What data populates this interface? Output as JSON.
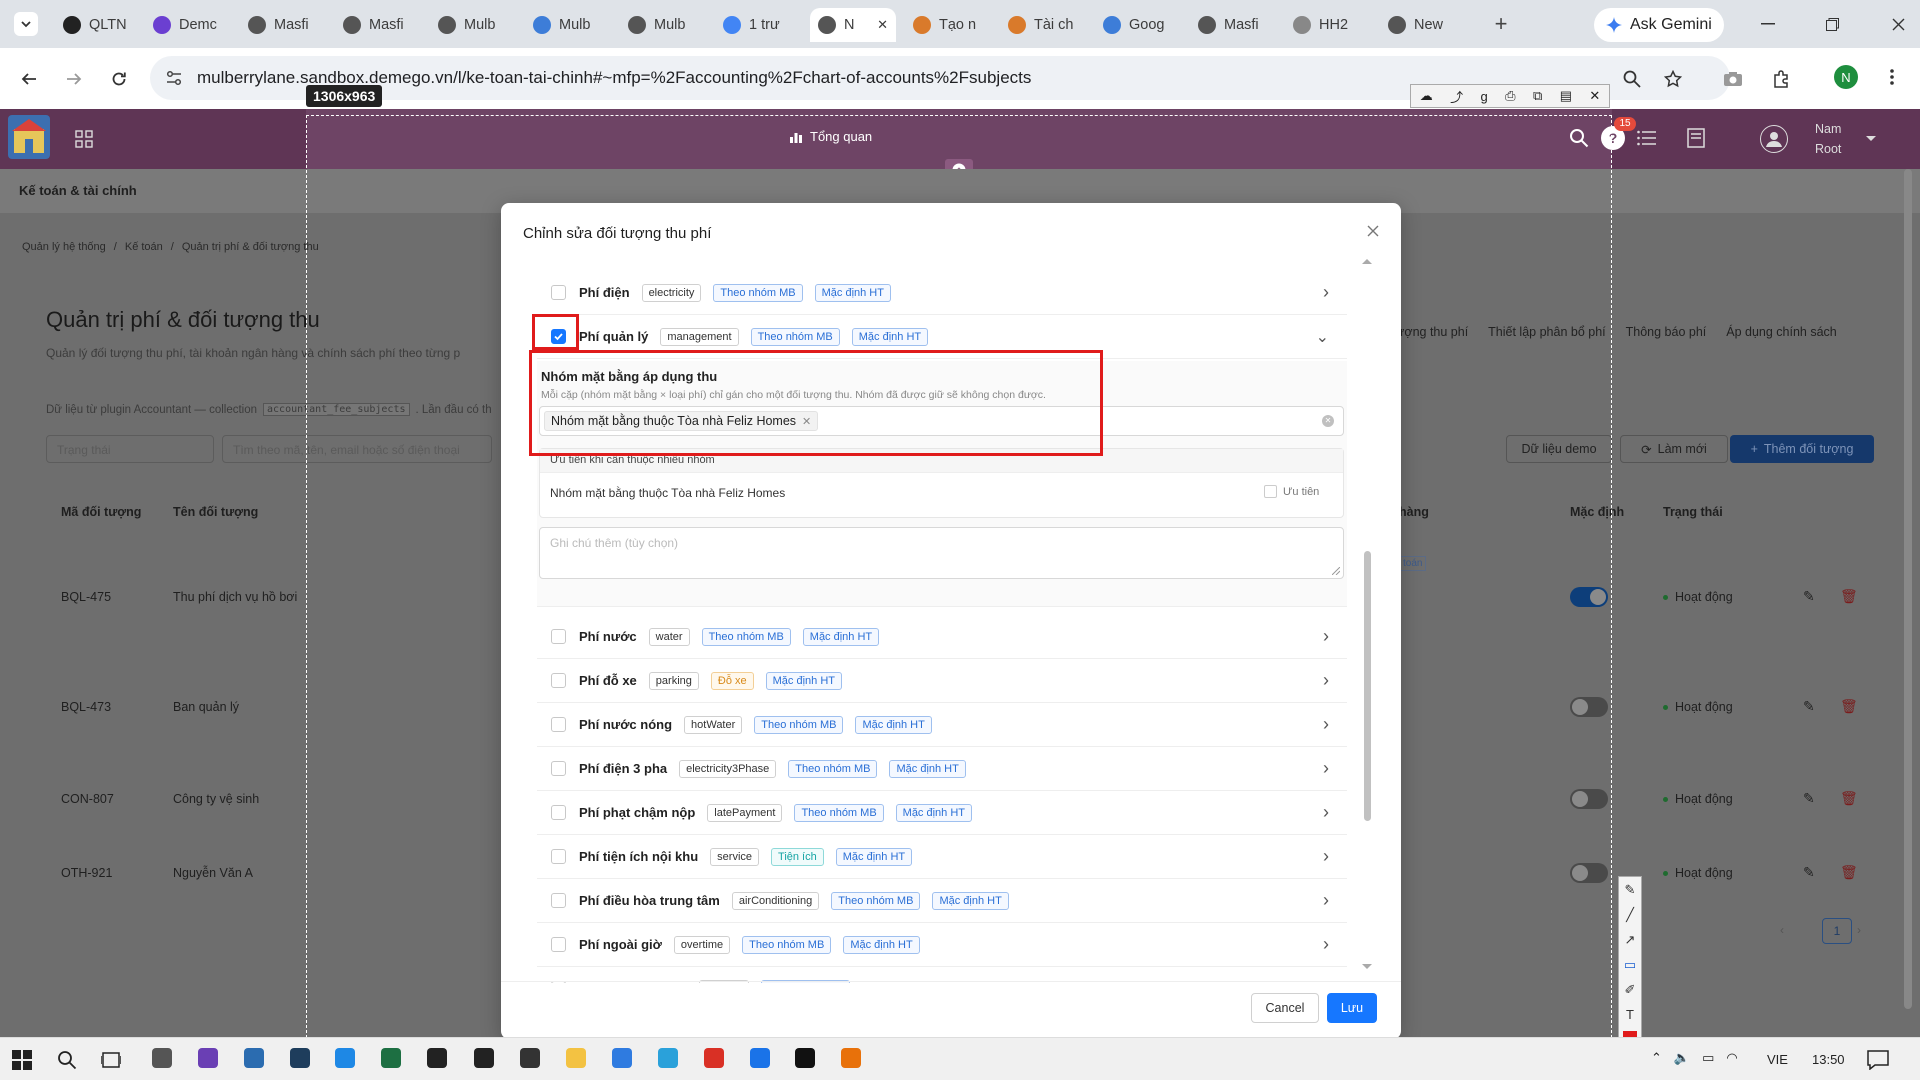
{
  "browser": {
    "tabs": [
      {
        "label": "QLTN",
        "color": "#222"
      },
      {
        "label": "Demc",
        "color": "#6b3fd1"
      },
      {
        "label": "Masfi",
        "color": "#555"
      },
      {
        "label": "Masfi",
        "color": "#555"
      },
      {
        "label": "Mulb",
        "color": "#555"
      },
      {
        "label": "Mulb",
        "color": "#3d7dd8"
      },
      {
        "label": "Mulb",
        "color": "#555"
      },
      {
        "label": "1 trư",
        "color": "#4285f4"
      },
      {
        "label": "N",
        "color": "#555"
      },
      {
        "label": "Tạo n",
        "color": "#d97a2b"
      },
      {
        "label": "Tài ch",
        "color": "#d97a2b"
      },
      {
        "label": "Goog",
        "color": "#3d7dd8"
      },
      {
        "label": "Masfi",
        "color": "#555"
      },
      {
        "label": "HH2",
        "color": "#888"
      },
      {
        "label": "New",
        "color": "#555"
      }
    ],
    "ask_gemini": "Ask Gemini",
    "url": "mulberrylane.sandbox.demego.vn/l/ke-toan-tai-chinh#~mfp=%2Faccounting%2Fchart-of-accounts%2Fsubjects",
    "profile_initial": "N"
  },
  "capture": {
    "size_label": "1306x963"
  },
  "app": {
    "header_center": "Tổng quan",
    "notification_count": "15",
    "user_first": "Nam",
    "user_last": "Root",
    "module_title": "Kế toán & tài chính",
    "breadcrumb": [
      "Quản lý hệ thống",
      "Kế toán",
      "Quản trị phí & đối tượng thu"
    ],
    "page_title": "Quản trị phí & đối tượng thu",
    "page_subtitle": "Quản lý đối tượng thu phí, tài khoản ngân hàng và chính sách phí theo từng p",
    "plugin_note": "Dữ liệu từ plugin Accountant — collection",
    "plugin_code": "accountant_fee_subjects",
    "plugin_note_tail": ". Lần đầu có th",
    "status_filter_placeholder": "Trạng thái",
    "search_placeholder": "Tìm theo mã, tên, email hoặc số điện thoại",
    "tabs_right": [
      "ượng thu phí",
      "Thiết lập phân bổ phí",
      "Thông báo phí",
      "Áp dụng chính sách"
    ],
    "btn_demo": "Dữ liệu demo",
    "btn_refresh": "Làm mới",
    "btn_add": "Thêm đối tượng",
    "table_headers": {
      "code": "Mã đối tượng",
      "name": "Tên đối tượng",
      "bank": "hàng",
      "default": "Mặc định",
      "status": "Trạng thái"
    },
    "rows": [
      {
        "code": "BQL-475",
        "name": "Thu phí dịch vụ hồ bơi",
        "status": "Hoạt động",
        "default_on": true
      },
      {
        "code": "BQL-473",
        "name": "Ban quản lý",
        "status": "Hoạt động",
        "default_on": false
      },
      {
        "code": "CON-807",
        "name": "Công ty vệ sinh",
        "status": "Hoạt động",
        "default_on": false
      },
      {
        "code": "OTH-921",
        "name": "Nguyễn Văn A",
        "status": "Hoạt động",
        "default_on": false
      }
    ],
    "bank_tag": "toán",
    "page_number": "1"
  },
  "modal": {
    "title": "Chỉnh sửa đối tượng thu phí",
    "fees": [
      {
        "name": "Phí điện",
        "code": "electricity",
        "tags": [
          {
            "t": "Theo nhóm MB",
            "c": "blue"
          },
          {
            "t": "Mặc định HT",
            "c": "blue"
          }
        ],
        "checked": false
      },
      {
        "name": "Phí quản lý",
        "code": "management",
        "tags": [
          {
            "t": "Theo nhóm MB",
            "c": "blue"
          },
          {
            "t": "Mặc định HT",
            "c": "blue"
          }
        ],
        "checked": true
      },
      {
        "name": "Phí nước",
        "code": "water",
        "tags": [
          {
            "t": "Theo nhóm MB",
            "c": "blue"
          },
          {
            "t": "Mặc định HT",
            "c": "blue"
          }
        ],
        "checked": false
      },
      {
        "name": "Phí đỗ xe",
        "code": "parking",
        "tags": [
          {
            "t": "Đỗ xe",
            "c": "orange"
          },
          {
            "t": "Mặc định HT",
            "c": "blue"
          }
        ],
        "checked": false
      },
      {
        "name": "Phí nước nóng",
        "code": "hotWater",
        "tags": [
          {
            "t": "Theo nhóm MB",
            "c": "blue"
          },
          {
            "t": "Mặc định HT",
            "c": "blue"
          }
        ],
        "checked": false
      },
      {
        "name": "Phí điện 3 pha",
        "code": "electricity3Phase",
        "tags": [
          {
            "t": "Theo nhóm MB",
            "c": "blue"
          },
          {
            "t": "Mặc định HT",
            "c": "blue"
          }
        ],
        "checked": false
      },
      {
        "name": "Phí phạt chậm nộp",
        "code": "latePayment",
        "tags": [
          {
            "t": "Theo nhóm MB",
            "c": "blue"
          },
          {
            "t": "Mặc định HT",
            "c": "blue"
          }
        ],
        "checked": false
      },
      {
        "name": "Phí tiện ích nội khu",
        "code": "service",
        "tags": [
          {
            "t": "Tiện ích",
            "c": "cyan"
          },
          {
            "t": "Mặc định HT",
            "c": "blue"
          }
        ],
        "checked": false
      },
      {
        "name": "Phí điều hòa trung tâm",
        "code": "airConditioning",
        "tags": [
          {
            "t": "Theo nhóm MB",
            "c": "blue"
          },
          {
            "t": "Mặc định HT",
            "c": "blue"
          }
        ],
        "checked": false
      },
      {
        "name": "Phí ngoài giờ",
        "code": "overtime",
        "tags": [
          {
            "t": "Theo nhóm MB",
            "c": "blue"
          },
          {
            "t": "Mặc định HT",
            "c": "blue"
          }
        ],
        "checked": false
      },
      {
        "name": "Phí rác / xử lý rác",
        "code": "custom",
        "tags": [
          {
            "t": "Theo nhóm MB",
            "c": "blue"
          }
        ],
        "checked": false
      }
    ],
    "group_section_title": "Nhóm mặt bằng áp dụng thu",
    "group_section_hint": "Mỗi cặp (nhóm mặt bằng × loại phí) chỉ gán cho một đối tượng thu. Nhóm đã được giữ sẽ không chọn được.",
    "selected_group": "Nhóm mặt bằng thuộc Tòa nhà Feliz Homes",
    "priority_header": "Ưu tiên khi cần thuộc nhiều nhóm",
    "priority_item": "Nhóm mặt bằng thuộc Tòa nhà Feliz Homes",
    "priority_label": "Ưu tiên",
    "note_placeholder": "Ghi chú thêm (tùy chọn)",
    "cancel": "Cancel",
    "save": "Lưu"
  },
  "taskbar": {
    "lang": "VIE",
    "time": "13:50"
  }
}
